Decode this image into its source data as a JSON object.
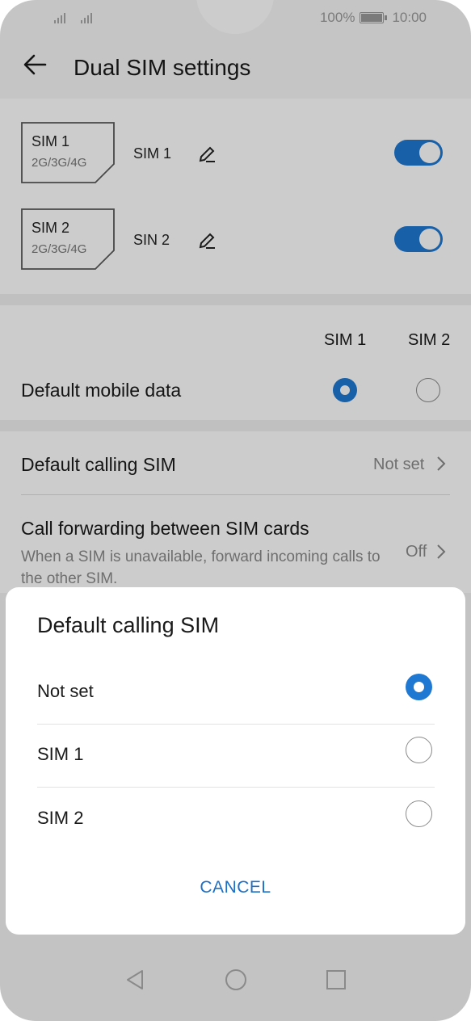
{
  "status_bar": {
    "battery": "100%",
    "time": "10:00"
  },
  "header": {
    "title": "Dual SIM settings"
  },
  "sims": [
    {
      "card_name": "SIM 1",
      "network": "2G/3G/4G",
      "label": "SIM 1",
      "enabled": true
    },
    {
      "card_name": "SIM 2",
      "network": "2G/3G/4G",
      "label": "SIN 2",
      "enabled": true
    }
  ],
  "default_data": {
    "col_sim1": "SIM 1",
    "col_sim2": "SIM 2",
    "label": "Default mobile data",
    "selected": "SIM 1"
  },
  "calling": {
    "label": "Default calling SIM",
    "value": "Not set"
  },
  "forwarding": {
    "label": "Call forwarding between SIM cards",
    "description": "When a SIM is unavailable, forward incoming calls to the other SIM.",
    "value": "Off"
  },
  "dialog": {
    "title": "Default calling SIM",
    "options": [
      "Not set",
      "SIM 1",
      "SIM 2"
    ],
    "selected": "Not set",
    "cancel_label": "CANCEL"
  },
  "colors": {
    "accent": "#1f78d1",
    "cancel": "#1f6fc4"
  },
  "icons": [
    "back-arrow-icon",
    "pencil-icon",
    "chevron-right-icon",
    "nav-back-icon",
    "nav-home-icon",
    "nav-recents-icon",
    "signal-icon",
    "battery-icon"
  ]
}
